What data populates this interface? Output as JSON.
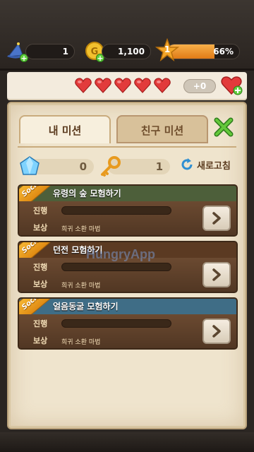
{
  "resources": {
    "wand_count": "1",
    "gold": "1,100",
    "level": "1",
    "xp_percent_text": "66%",
    "xp_percent": 66
  },
  "hearts": {
    "count": 5,
    "extra_label": "+0"
  },
  "tabs": [
    {
      "label": "내 미션"
    },
    {
      "label": "친구 미션"
    }
  ],
  "counters": {
    "gem": "0",
    "key": "1",
    "refresh_label": "새로고침"
  },
  "missions": [
    {
      "badge": "Social",
      "title": "유령의 숲 모험하기",
      "progress_label": "진행",
      "reward_label": "보상",
      "reward": "희귀 소환 마법",
      "head_color": "#4d5f3a"
    },
    {
      "badge": "Social",
      "title": "던전 모험하기",
      "progress_label": "진행",
      "reward_label": "보상",
      "reward": "희귀 소환 마법",
      "head_color": "#5b3a22"
    },
    {
      "badge": "Social",
      "title": "얼음동굴 모험하기",
      "progress_label": "진행",
      "reward_label": "보상",
      "reward": "희귀 소환 마법",
      "head_color": "#3f6d86"
    }
  ],
  "watermark": "HungryApp"
}
